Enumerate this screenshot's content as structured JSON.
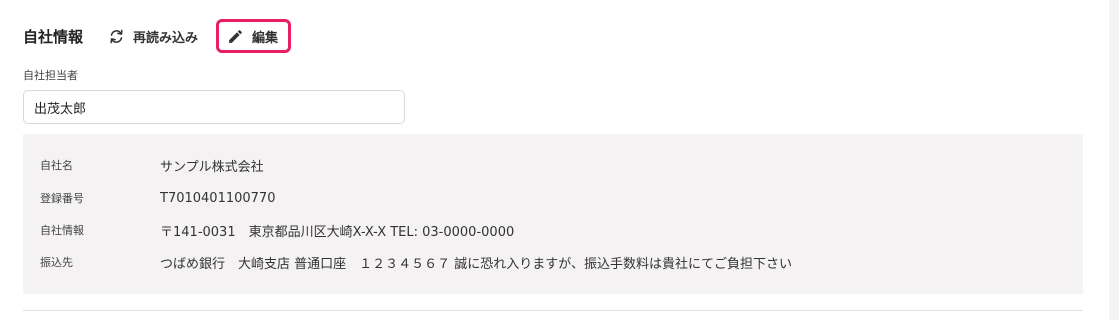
{
  "header": {
    "title": "自社情報",
    "reload_label": "再読み込み",
    "edit_label": "編集"
  },
  "person": {
    "label": "自社担当者",
    "value": "出茂太郎"
  },
  "company": {
    "rows": [
      {
        "label": "自社名",
        "value": "サンプル株式会社"
      },
      {
        "label": "登録番号",
        "value": "T7010401100770"
      },
      {
        "label": "自社情報",
        "value": "〒141-0031　東京都品川区大崎X-X-X TEL: 03-0000-0000"
      },
      {
        "label": "振込先",
        "value": "つばめ銀行　大崎支店 普通口座　１２３４５６７ 誠に恐れ入りますが、振込手数料は貴社にてご負担下さい"
      }
    ]
  },
  "colors": {
    "edit_highlight": "#e91e63",
    "info_background": "#f4f2f2"
  },
  "icons": {
    "reload": "refresh-icon",
    "edit": "pencil-icon"
  }
}
